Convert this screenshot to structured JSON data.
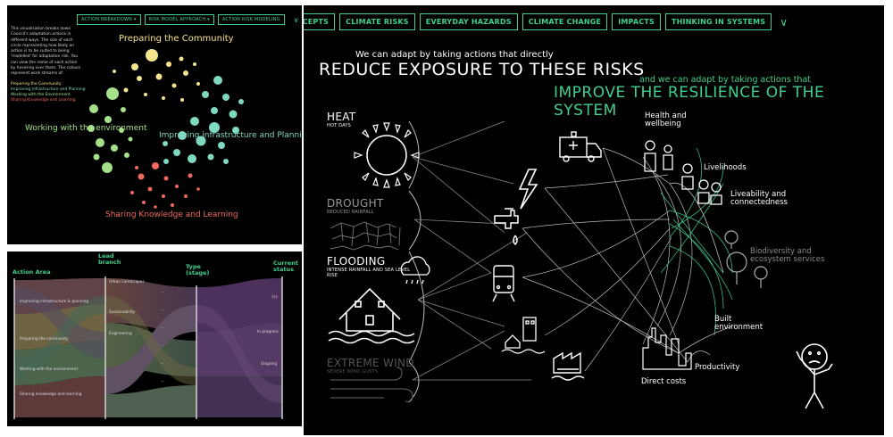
{
  "left": {
    "nav": [
      "ACTION BREAKDOWN ▾",
      "RISK MODEL APPROACH ▾",
      "ACTION RISK MODELING"
    ],
    "intro": "This visualisation breaks down Council's adaptation actions in different ways. The size of each circle representing how likely an action is to be suited to being 'modelled' for adaptation risk. You can view the name of each action by hovering over them. The colours represent work streams of:",
    "streams": [
      {
        "label": "Preparing the Community",
        "color": "#f5e58c"
      },
      {
        "label": "Improving Infrastructure and Planning",
        "color": "#7fd8c0"
      },
      {
        "label": "Working with the Environment",
        "color": "#a6e08a"
      },
      {
        "label": "Sharing Knowledge and Learning",
        "color": "#f06a5e"
      }
    ],
    "clusters": {
      "community": "Preparing the Community",
      "environment": "Working with the environment",
      "infrastructure": "Improving infrastructure and Planning",
      "knowledge": "Sharing Knowledge and Learning"
    },
    "parallel": {
      "headers": [
        "Action Area",
        "Lead branch",
        "Type (stage)",
        "Current status"
      ],
      "areas": [
        "Improving infrastructure & planning",
        "Preparing the community",
        "Working with the environment",
        "Sharing knowledge and learning"
      ],
      "branches": [
        "Urban Landscapes",
        "Sustainability",
        "Engineering"
      ],
      "statuses": [
        "???",
        "In progress",
        "Ongoing"
      ]
    }
  },
  "main": {
    "nav": [
      "CONCEPTS",
      "CLIMATE RISKS",
      "EVERYDAY HAZARDS",
      "CLIMATE CHANGE",
      "IMPACTS",
      "THINKING IN SYSTEMS"
    ],
    "reduce_small": "We can adapt by taking actions that directly",
    "reduce_big": "REDUCE EXPOSURE TO THESE RISKS",
    "improve_small": "and we can adapt by taking actions that",
    "improve_big": "IMPROVE THE RESILIENCE OF THE SYSTEM",
    "risks": [
      {
        "title": "HEAT",
        "sub": "HOT DAYS"
      },
      {
        "title": "DROUGHT",
        "sub": "REDUCED RAINFALL"
      },
      {
        "title": "FLOODING",
        "sub": "INTENSE RAINFALL AND SEA LEVEL RISE"
      },
      {
        "title": "EXTREME WIND",
        "sub": "SEVERE WIND GUSTS"
      }
    ],
    "outcomes": {
      "health": "Health and wellbeing",
      "livelihoods": "Livelihoods",
      "liveability": "Liveability and connectedness",
      "biodiversity": "Biodiversity and ecosystem services",
      "built": "Built environment",
      "productivity": "Productivity",
      "direct": "Direct costs"
    }
  }
}
